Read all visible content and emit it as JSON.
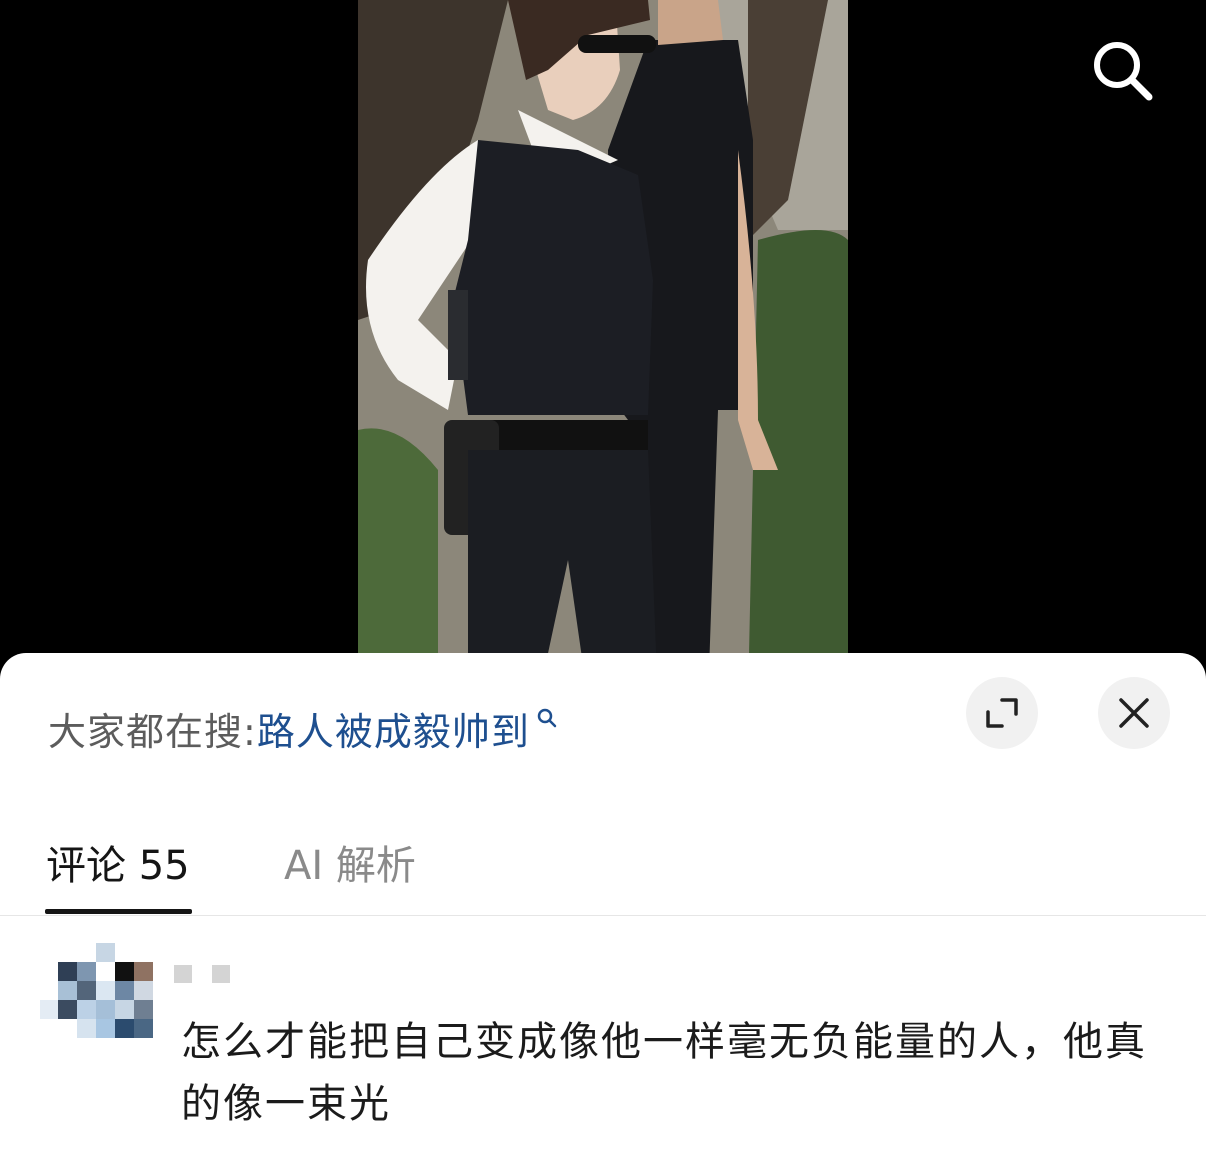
{
  "search_bar": {
    "prefix": "大家都在搜:",
    "term": "路人被成毅帅到"
  },
  "icons": {
    "top_search": "search-icon",
    "term_search": "search-icon",
    "expand": "expand-icon",
    "close": "close-icon"
  },
  "tabs": [
    {
      "label": "评论 55",
      "active": true
    },
    {
      "label": "AI 解析",
      "active": false
    }
  ],
  "comment": {
    "text": "怎么才能把自己变成像他一样毫无负能量的人，他真的像一束光"
  },
  "colors": {
    "search_term": "#1e4f8f",
    "active_tab": "#151515",
    "inactive_tab": "#8a8a8a"
  }
}
